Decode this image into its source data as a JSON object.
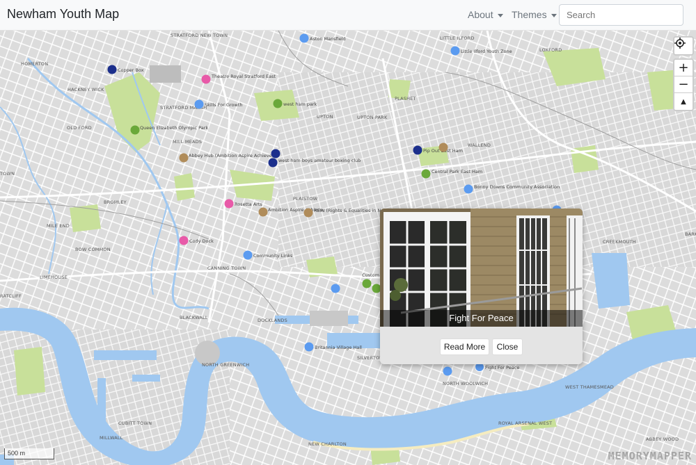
{
  "navbar": {
    "title": "Newham Youth Map",
    "about": "About",
    "themes": "Themes",
    "search_placeholder": "Search"
  },
  "map": {
    "scale_label": "500 m",
    "watermark": "MEMORYMAPPER",
    "area_labels": [
      "STRATFORD NEW TOWN",
      "HOMERTON",
      "HACKNEY WICK",
      "STRATFORD MARSH",
      "OLD FORD",
      "MILL MEADS",
      "UPTON",
      "UPTON PARK",
      "PLASHET",
      "LITTLE ILFORD",
      "LOXFORD",
      "WALLEND",
      "BROMLEY",
      "MILE END",
      "BOW COMMON",
      "PLAISTOW",
      "CANNING TOWN",
      "LIMEHOUSE",
      "RATCLIFF",
      "BLACKWALL",
      "DOCKLANDS",
      "NORTH GREENWICH",
      "CUBITT TOWN",
      "MILLWALL",
      "NEW CHARLTON",
      "NORTH WOOLWICH",
      "SILVERTOWN",
      "WEST THAMESMEAD",
      "ROYAL ARSENAL WEST",
      "ABBEY WOOD",
      "CREEKMOUTH",
      "BARKING RIVERSIDE",
      "TOWN"
    ],
    "places": [
      "Aston Mansfield",
      "Little Ilford Youth Zone",
      "Copper Box",
      "Theatre Royal Stratford East",
      "Skills For Growth",
      "west ham park",
      "Queen Elizabeth Olympic Park",
      "Abbey Hub (Ambition Aspire Achieve)",
      "west ham boys amateur boxing club",
      "Pip Out East Ham",
      "Central Park East Ham",
      "Bonny Downs Community Association",
      "Rosetta Arts",
      "Ambition Aspire Achieve",
      "REIN (Rights & Equalities in Newham)",
      "Cody Dock",
      "Community Links",
      "Custom House",
      "Britannia Village Hall",
      "Fight For Peace"
    ]
  },
  "popup": {
    "title": "Fight For Peace",
    "read_more": "Read More",
    "close": "Close"
  },
  "controls": {
    "locate_icon": "locate-icon",
    "zoom_in": "+",
    "zoom_out": "−",
    "compass": "▲"
  },
  "colors": {
    "water": "#a0c8f0",
    "park": "#c8e09a",
    "marker_blue": "#5b9bf0",
    "marker_navy": "#1c2f8c",
    "marker_green": "#6aa83a",
    "marker_pink": "#e85aa8",
    "marker_brown": "#b08c5a"
  }
}
